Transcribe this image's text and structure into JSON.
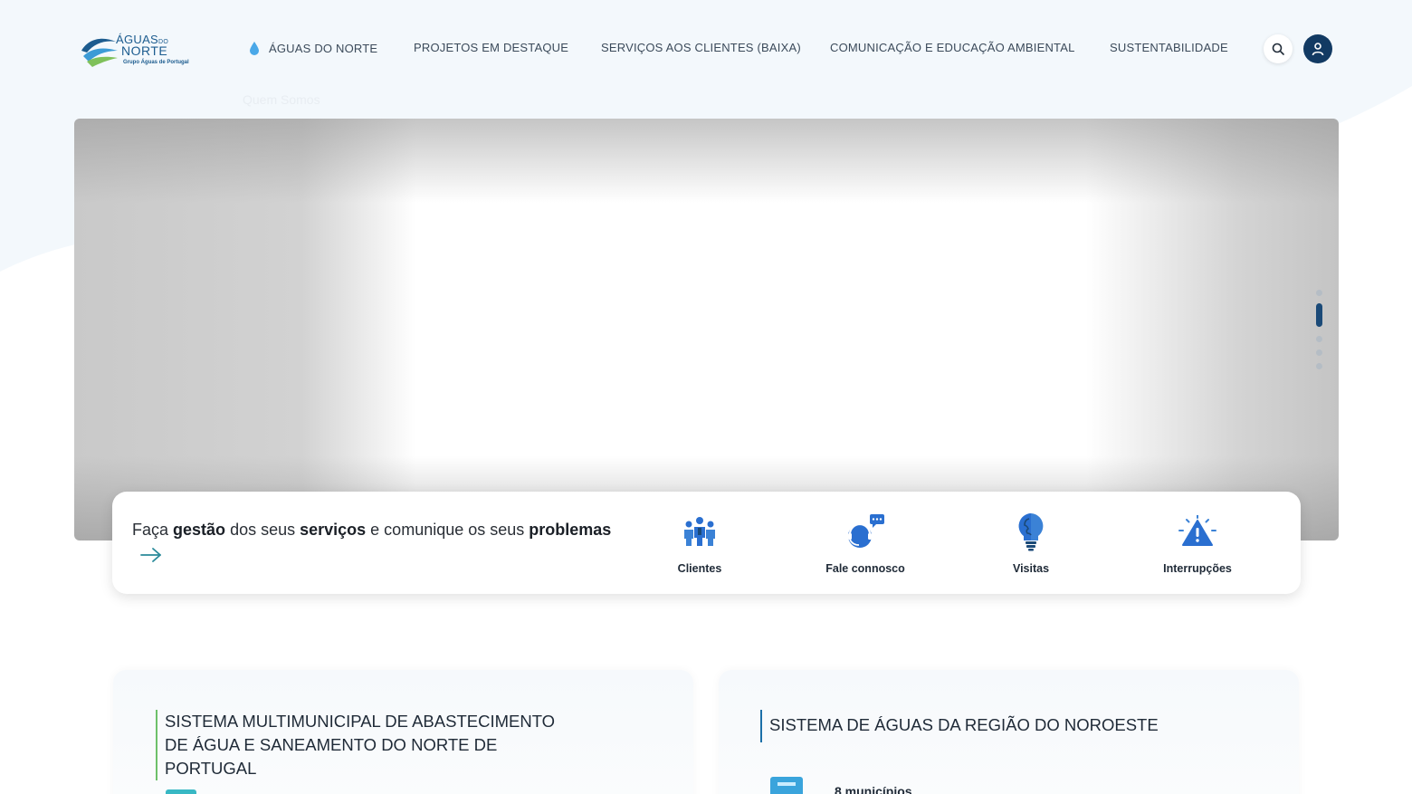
{
  "logo": {
    "line1": "ÁGUAS",
    "line1_small": "DO",
    "line2": "NORTE",
    "tagline": "Grupo Águas de Portugal"
  },
  "nav": {
    "items": [
      {
        "label": "ÁGUAS DO NORTE",
        "icon": "water-drop-icon"
      },
      {
        "label": "PROJETOS EM DESTAQUE"
      },
      {
        "label": "SERVIÇOS AOS CLIENTES (BAIXA)"
      },
      {
        "label": "COMUNICAÇÃO E EDUCAÇÃO AMBIENTAL"
      },
      {
        "label": "SUSTENTABILIDADE"
      }
    ],
    "submenu_ghost": "Quem Somos"
  },
  "hero": {
    "slides_total": 5,
    "active_slide": 2
  },
  "services": {
    "prompt": {
      "part1": "Faça ",
      "bold1": "gestão",
      "part2": " dos seus ",
      "bold2": "serviços",
      "part3": " e comunique os seus ",
      "bold3": "problemas"
    },
    "items": [
      {
        "label": "Clientes",
        "icon": "people-group-icon"
      },
      {
        "label": "Fale connosco",
        "icon": "headset-chat-icon"
      },
      {
        "label": "Visitas",
        "icon": "lightbulb-head-icon"
      },
      {
        "label": "Interrupções",
        "icon": "warning-alert-icon"
      }
    ]
  },
  "cards": {
    "left": {
      "title": "SISTEMA MULTIMUNICIPAL DE ABASTECIMENTO DE ÁGUA E SANEAMENTO DO NORTE DE PORTUGAL"
    },
    "right": {
      "title": "SISTEMA DE ÁGUAS DA REGIÃO DO NOROESTE",
      "stat": "8 municípios"
    }
  },
  "colors": {
    "brand_navy": "#123a63",
    "accent_blue": "#2a6fd0",
    "accent_green": "#6ec06a",
    "text_dark": "#1f2a37"
  }
}
